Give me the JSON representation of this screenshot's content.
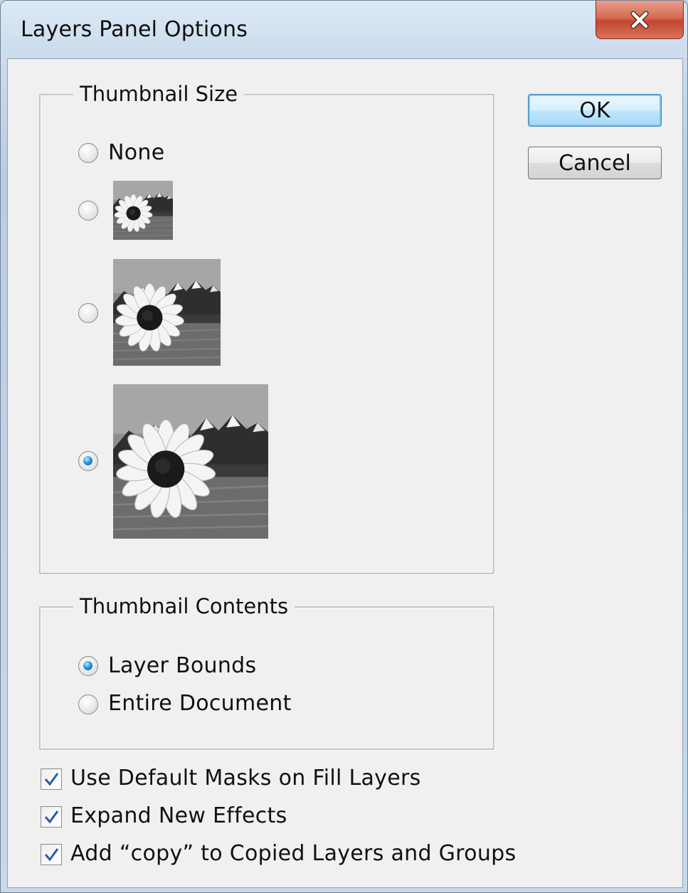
{
  "dialog": {
    "title": "Layers Panel Options"
  },
  "buttons": {
    "ok_label": "OK",
    "cancel_label": "Cancel"
  },
  "thumbnail_size": {
    "legend": "Thumbnail Size",
    "options": [
      {
        "label": "None",
        "selected": false
      },
      {
        "label": "",
        "selected": false
      },
      {
        "label": "",
        "selected": false
      },
      {
        "label": "",
        "selected": true
      }
    ]
  },
  "thumbnail_contents": {
    "legend": "Thumbnail Contents",
    "options": [
      {
        "label": "Layer Bounds",
        "selected": true
      },
      {
        "label": "Entire Document",
        "selected": false
      }
    ]
  },
  "checkboxes": [
    {
      "label": "Use Default Masks on Fill Layers",
      "checked": true
    },
    {
      "label": "Expand New Effects",
      "checked": true
    },
    {
      "label": "Add “copy” to Copied Layers and Groups",
      "checked": true
    }
  ],
  "colors": {
    "accent": "#1f7fc8",
    "close_button": "#c9503a",
    "dialog_face": "#f0f0f0"
  },
  "icons": {
    "close": "close-x-icon",
    "check": "checkmark-icon"
  }
}
